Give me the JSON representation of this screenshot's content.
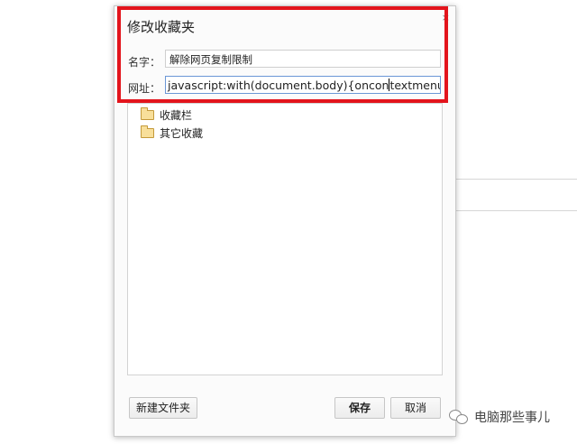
{
  "dialog": {
    "title": "修改收藏夹",
    "close_glyph": "×",
    "name_label": "名字：",
    "name_value": "解除网页复制限制",
    "url_label": "网址：",
    "url_value_before_caret": "javascript:with(document.body){oncon",
    "url_value_after_caret": "textmenu='';or"
  },
  "folders": [
    {
      "label": "收藏栏",
      "icon": "open-folder-icon"
    },
    {
      "label": "其它收藏",
      "icon": "folder-icon"
    }
  ],
  "buttons": {
    "new_folder": "新建文件夹",
    "save": "保存",
    "cancel": "取消"
  },
  "watermark": {
    "text": "电脑那些事儿",
    "icon": "wechat-icon"
  },
  "colors": {
    "highlight": "#e3141c",
    "url_focus_border": "#6b97d6",
    "folder": "#f8df9a"
  }
}
